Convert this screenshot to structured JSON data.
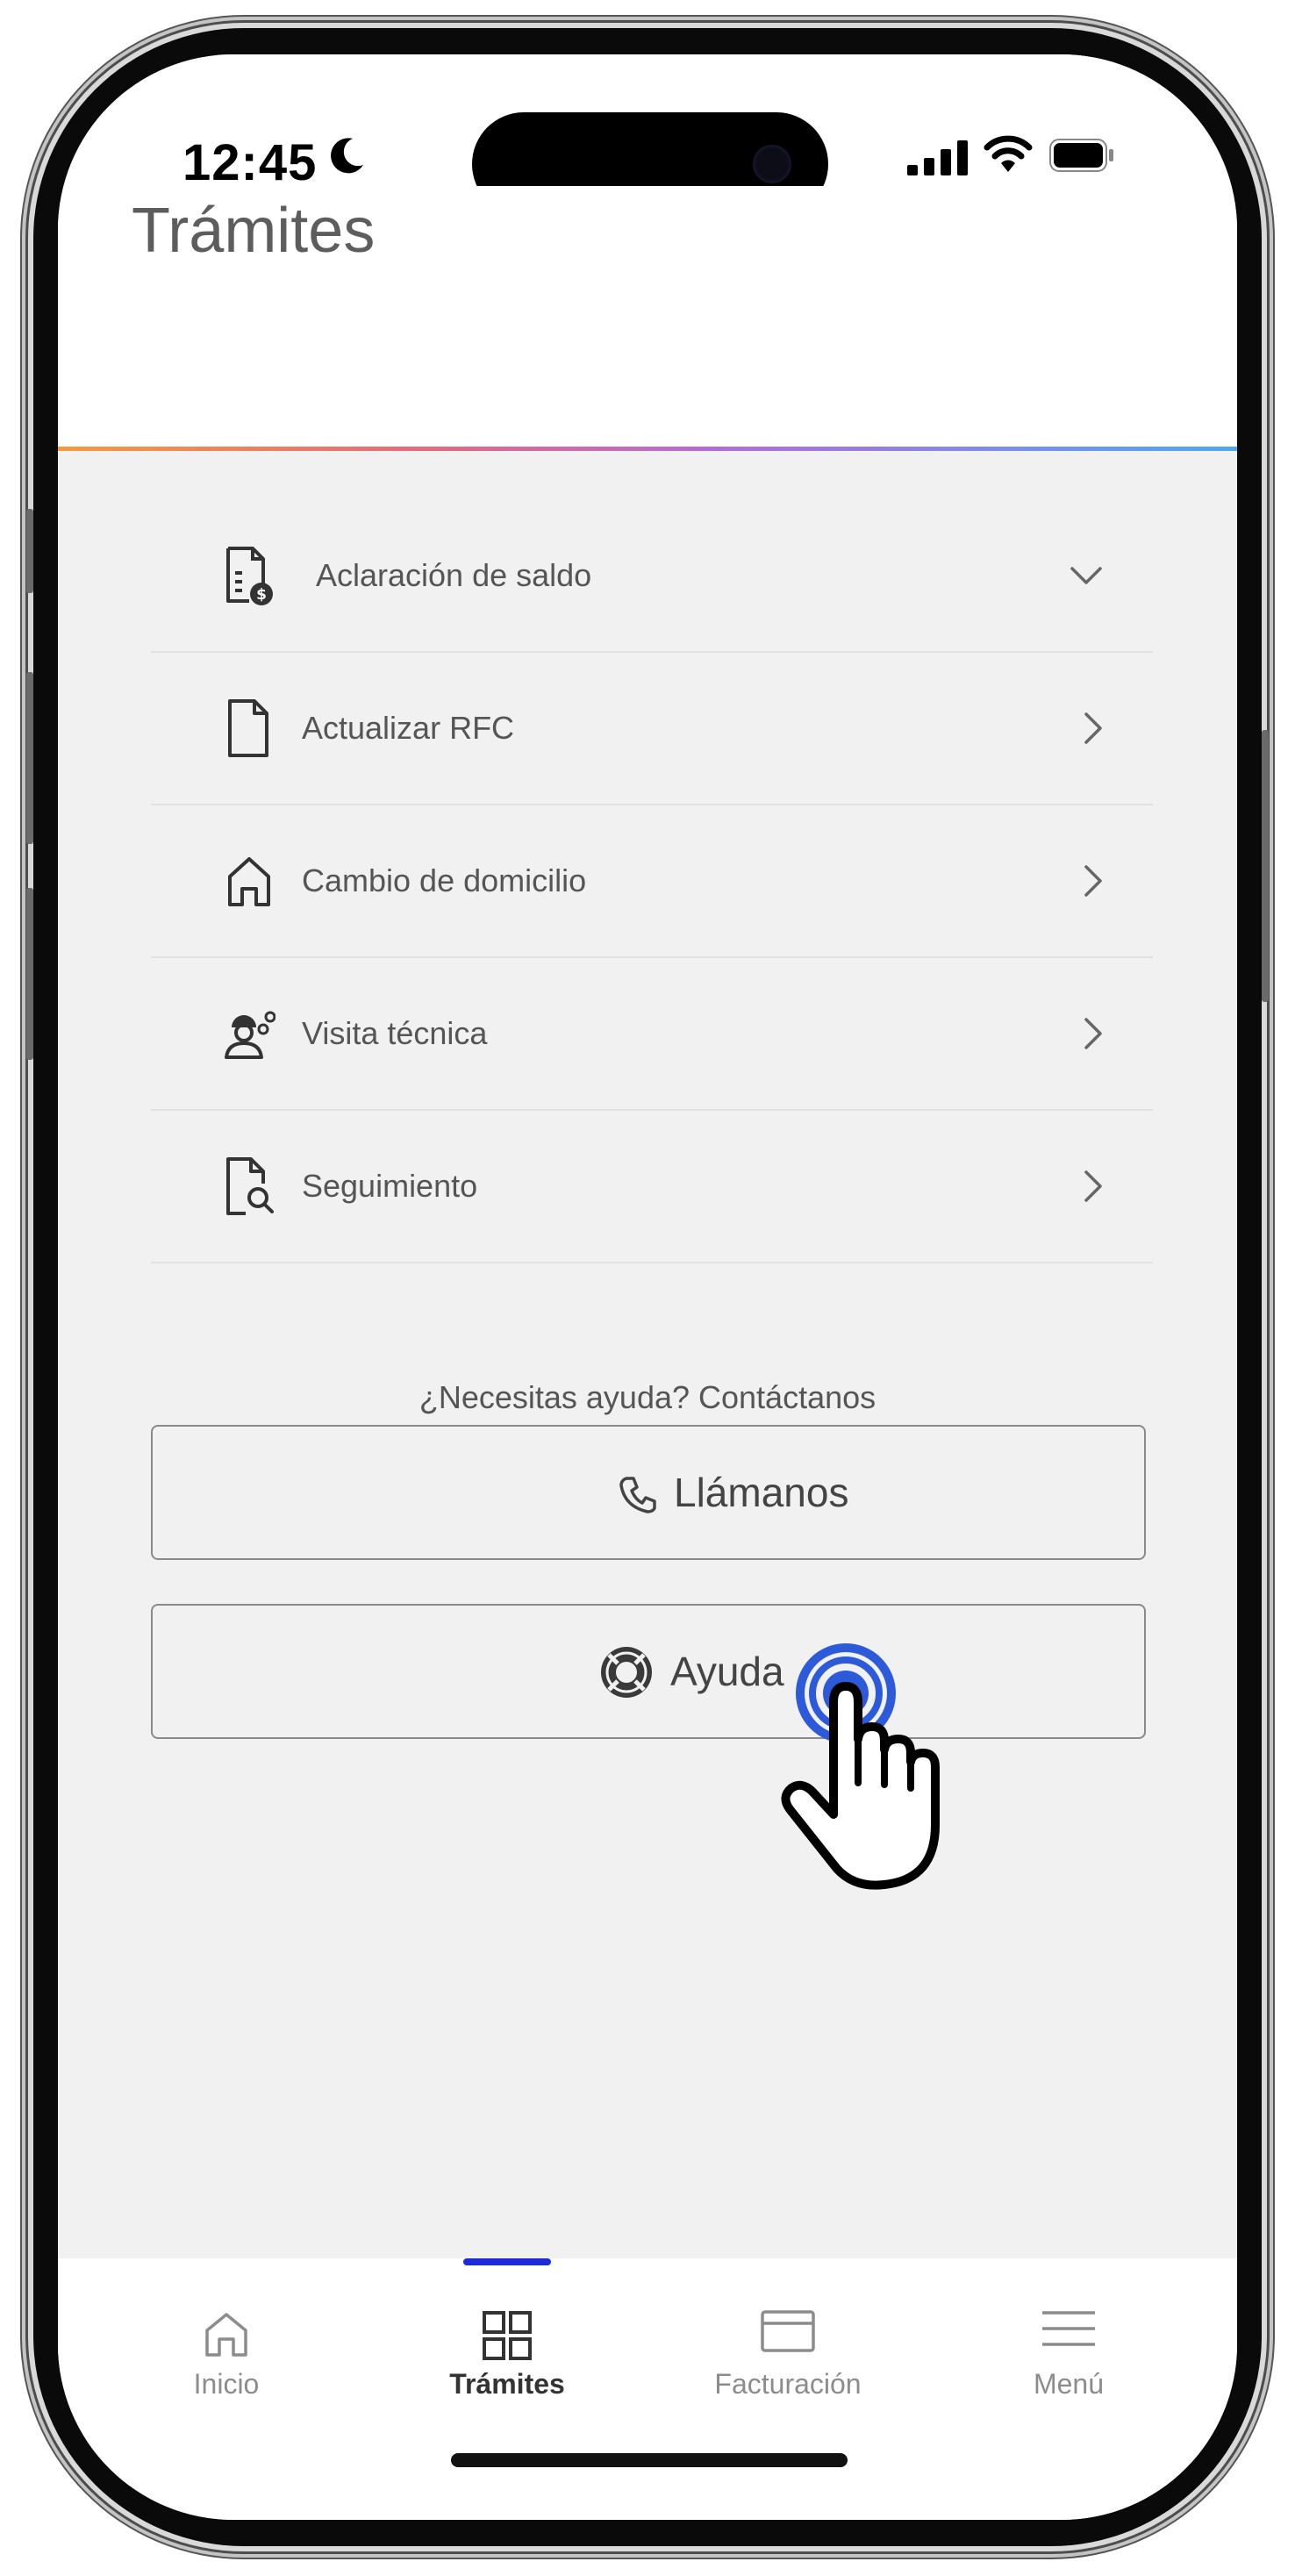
{
  "status_bar": {
    "time": "12:45"
  },
  "header": {
    "title": "Trámites"
  },
  "menu_items": [
    {
      "label": "Aclaración de saldo",
      "icon": "document-dollar-icon",
      "chevron": "chevron-down-icon"
    },
    {
      "label": "Actualizar RFC",
      "icon": "document-icon",
      "chevron": "chevron-right-icon"
    },
    {
      "label": "Cambio de domicilio",
      "icon": "home-icon",
      "chevron": "chevron-right-icon"
    },
    {
      "label": "Visita técnica",
      "icon": "technician-icon",
      "chevron": "chevron-right-icon"
    },
    {
      "label": "Seguimiento",
      "icon": "document-search-icon",
      "chevron": "chevron-right-icon"
    }
  ],
  "help": {
    "prompt": "¿Necesitas ayuda? Contáctanos",
    "call_label": "Llámanos",
    "help_label": "Ayuda"
  },
  "tabs": [
    {
      "label": "Inicio",
      "icon": "home-icon",
      "active": false
    },
    {
      "label": "Trámites",
      "icon": "grid-icon",
      "active": true
    },
    {
      "label": "Facturación",
      "icon": "card-icon",
      "active": false
    },
    {
      "label": "Menú",
      "icon": "hamburger-icon",
      "active": false
    }
  ],
  "colors": {
    "tab_indicator": "#1e2ad6",
    "tap_indicator": "#2c5ad8",
    "background": "#f1f1f1"
  }
}
